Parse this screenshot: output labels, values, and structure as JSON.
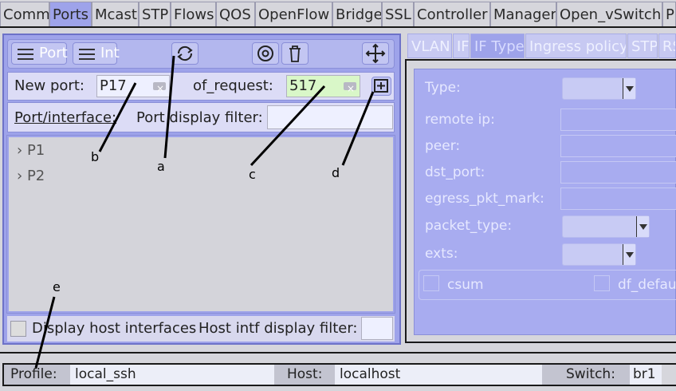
{
  "tabs": [
    "Comm",
    "Ports",
    "Mcast",
    "STP",
    "Flows",
    "QOS",
    "OpenFlow",
    "Bridge",
    "SSL",
    "Controller",
    "Manager",
    "Open_vSwitch",
    "PL"
  ],
  "active_tab": "Ports",
  "toolbar": {
    "port_btn": "Port",
    "intf_btn": "Int"
  },
  "new_port": {
    "label": "New port:",
    "value": "P17",
    "of_request_label": "of_request:",
    "of_request_value": "517"
  },
  "filter": {
    "port_intf_label": "Port/interface:",
    "display_filter_label": "Port display filter:",
    "display_filter_value": ""
  },
  "tree_items": [
    "P1",
    "P2"
  ],
  "host": {
    "checkbox_label": "Display host interfaces",
    "filter_label": "Host intf display filter:"
  },
  "right_tabs": [
    "VLAN",
    "IF",
    "IF Type",
    "Ingress policy",
    "STP",
    "RS"
  ],
  "active_right_tab": "IF Type",
  "if_type": {
    "type_label": "Type:",
    "remote_ip_label": "remote ip:",
    "peer_label": "peer:",
    "dst_port_label": "dst_port:",
    "egress_label": "egress_pkt_mark:",
    "packet_type_label": "packet_type:",
    "exts_label": "exts:",
    "csum_label": "csum",
    "df_label": "df_defau"
  },
  "status": {
    "profile_label": "Profile:",
    "profile_value": "local_ssh",
    "host_label": "Host:",
    "host_value": "localhost",
    "switch_label": "Switch:",
    "switch_value": "br1"
  },
  "annotations": {
    "a": "a",
    "b": "b",
    "c": "c",
    "d": "d",
    "e": "e"
  },
  "colors": {
    "panel": "#9ea3ea",
    "input_green": "#d9f7c8",
    "chrome": "#d6d6dc"
  }
}
